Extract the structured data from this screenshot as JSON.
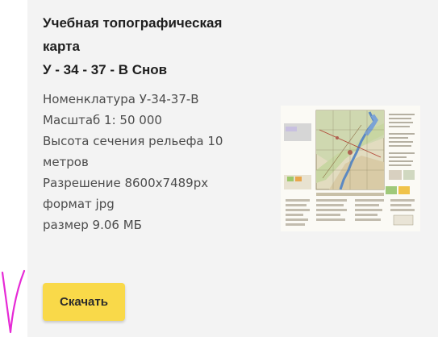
{
  "product": {
    "title_lines": [
      "Учебная топографическая",
      "карта",
      "У - 34 - 37 - В Снов"
    ],
    "specs": [
      "Номенклатура У-34-37-В",
      "Масштаб 1: 50 000",
      "Высота сечения рельефа 10",
      "метров",
      "Разрешение 8600x7489px",
      "формат jpg",
      "размер 9.06 МБ"
    ],
    "download_label": "Скачать"
  },
  "colors": {
    "card_bg": "#f3f3f3",
    "button_bg": "#f9d949",
    "annotation_stroke": "#e62ad6"
  }
}
